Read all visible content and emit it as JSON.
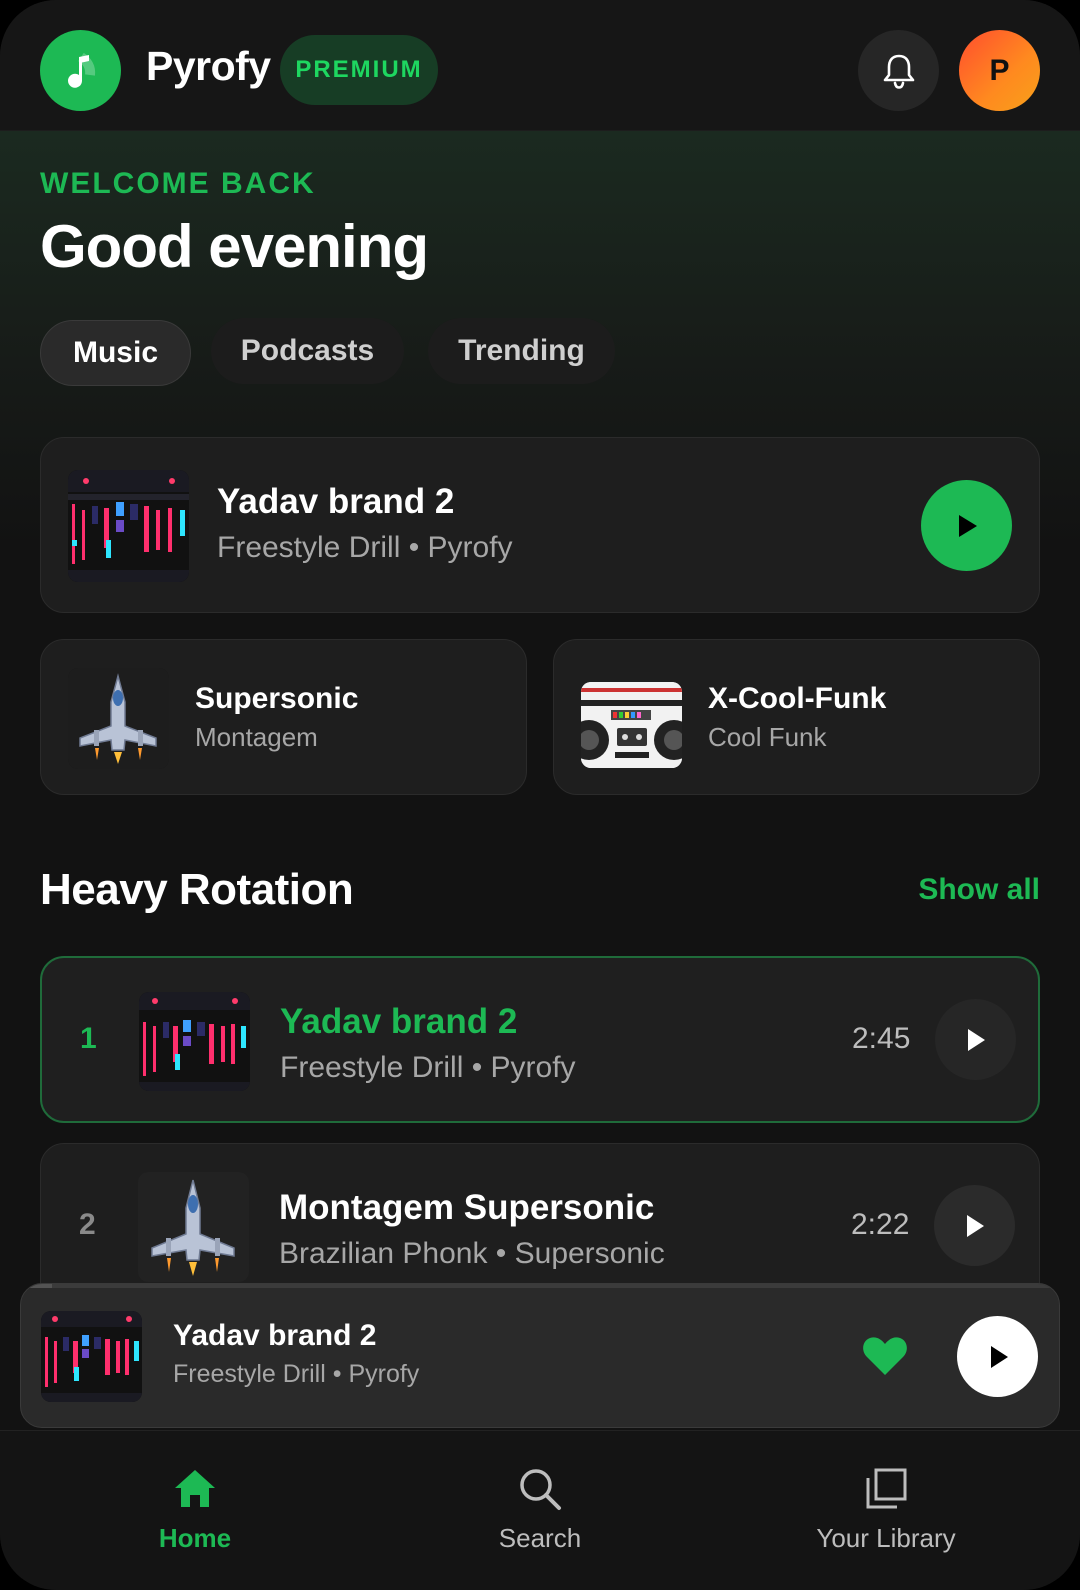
{
  "header": {
    "app_name": "Pyrofy",
    "badge": "PREMIUM",
    "avatar_initial": "P",
    "logo_icon": "music-note-icon",
    "bell_icon": "bell-icon"
  },
  "greeting": {
    "eyebrow": "WELCOME BACK",
    "title": "Good evening"
  },
  "tabs": [
    {
      "label": "Music",
      "active": true
    },
    {
      "label": "Podcasts",
      "active": false
    },
    {
      "label": "Trending",
      "active": false
    }
  ],
  "featured": {
    "title": "Yadav brand 2",
    "subtitle": "Freestyle Drill • Pyrofy",
    "art": "mixer-art"
  },
  "quick_picks": [
    {
      "title": "Supersonic",
      "subtitle": "Montagem",
      "art": "jet-art"
    },
    {
      "title": "X-Cool-Funk",
      "subtitle": "Cool Funk",
      "art": "boombox-art"
    }
  ],
  "section": {
    "title": "Heavy Rotation",
    "show_all": "Show all"
  },
  "tracks": [
    {
      "rank": "1",
      "title": "Yadav brand 2",
      "subtitle": "Freestyle Drill • Pyrofy",
      "duration": "2:45",
      "playing": true
    },
    {
      "rank": "2",
      "title": "Montagem Supersonic",
      "subtitle": "Brazilian Phonk • Supersonic",
      "duration": "2:22",
      "playing": false
    }
  ],
  "now_playing": {
    "title": "Yadav brand 2",
    "subtitle": "Freestyle Drill • Pyrofy",
    "liked": true,
    "progress": 0.03
  },
  "bottom_nav": [
    {
      "label": "Home",
      "icon": "home-icon",
      "active": true
    },
    {
      "label": "Search",
      "icon": "search-icon",
      "active": false
    },
    {
      "label": "Your Library",
      "icon": "library-icon",
      "active": false
    }
  ],
  "colors": {
    "accent": "#1db954",
    "background": "#121212",
    "card": "#1e1e1e"
  }
}
